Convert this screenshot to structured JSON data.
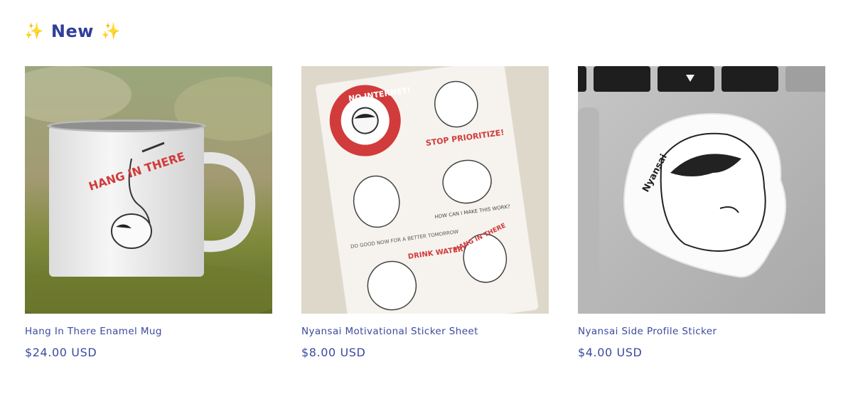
{
  "section": {
    "title": "New",
    "sparkle_left": "✨",
    "sparkle_right": "✨"
  },
  "products": [
    {
      "title": "Hang In There Enamel Mug",
      "price": "$24.00 USD",
      "image_icon": "mug-image"
    },
    {
      "title": "Nyansai Motivational Sticker Sheet",
      "price": "$8.00 USD",
      "image_icon": "sticker-sheet-image"
    },
    {
      "title": "Nyansai Side Profile Sticker",
      "price": "$4.00 USD",
      "image_icon": "sticker-image"
    }
  ],
  "artwork_text": {
    "mug": "HANG IN THERE",
    "sheet_no_internet": "NO INTERNET!",
    "sheet_stop": "STOP PRIORITIZE!",
    "sheet_how": "HOW CAN I MAKE THIS WORK?",
    "sheet_good": "DO GOOD NOW FOR A BETTER TOMORROW",
    "sheet_drink": "DRINK WATER!",
    "sheet_hang": "HANG IN THERE",
    "sticker": "Nyansai"
  },
  "colors": {
    "accent": "#2f3f9a",
    "sparkle": "#f2c14e",
    "sticker_red": "#d23b3b"
  }
}
